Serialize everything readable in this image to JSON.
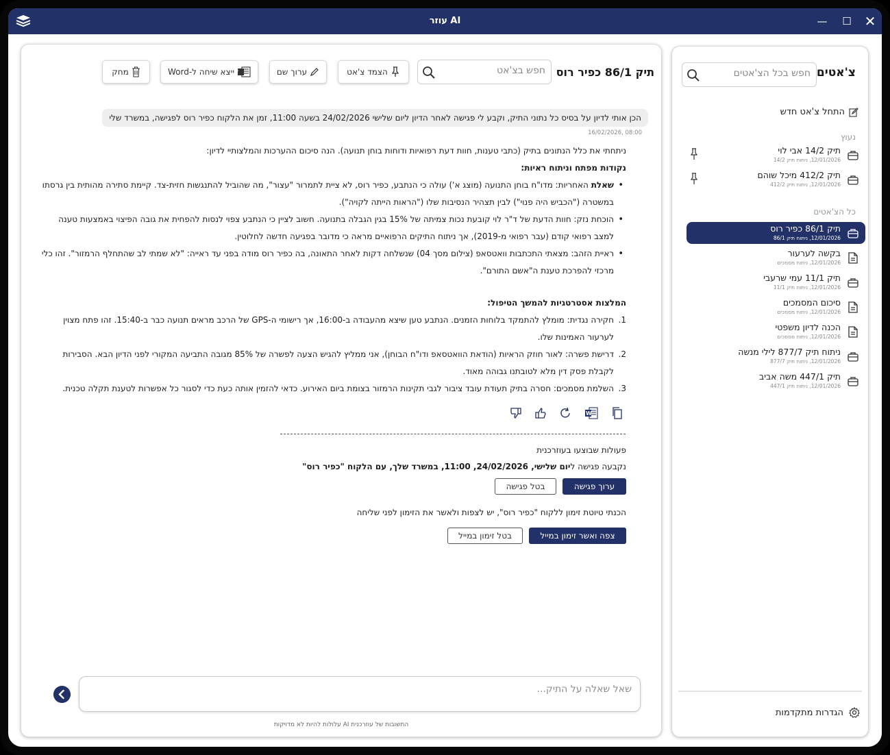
{
  "window": {
    "title": "עוזר AI",
    "minimize": "—",
    "maximize": "☐",
    "close": "✕"
  },
  "sidebar": {
    "title": "צ'אטים",
    "search_placeholder": "חפש בכל הצ'אטים",
    "new_chat": "התחל צ'אט חדש",
    "pinned_label": "נעוץ",
    "pinned": [
      {
        "name": "תיק 14/2 אבי לוי",
        "sub": "12/01/2026, ניתוח תיק 14/2",
        "icon": "briefcase-icon"
      },
      {
        "name": "תיק 412/2 מיכל שוהם",
        "sub": "12/01/2026, ניתוח תיק 412/2",
        "icon": "briefcase-icon"
      }
    ],
    "all_label": "כל הצ'אטים",
    "all": [
      {
        "name": "תיק 86/1 כפיר רוס",
        "sub": "12/01/2026, ניתוח תיק 86/1",
        "icon": "briefcase-icon"
      },
      {
        "name": "בקשה לערעור",
        "sub": "12/01/2026, ניתוח מסמכים",
        "icon": "document-icon"
      },
      {
        "name": "תיק 11/1 עמי שרעבי",
        "sub": "12/01/2026, ניתוח תיק 11/1",
        "icon": "briefcase-icon"
      },
      {
        "name": "סיכום המסמכים",
        "sub": "12/01/2026, ניתוח מסמכים",
        "icon": "document-icon"
      },
      {
        "name": "הכנה לדיון משפטי",
        "sub": "12/01/2026, ניתוח מסמכים",
        "icon": "document-icon"
      },
      {
        "name": "ניתוח תיק 877/7 לילי מנשה",
        "sub": "12/01/2026, ניתוח תיק 877/7",
        "icon": "briefcase-icon"
      },
      {
        "name": "תיק 447/1 משה אביב",
        "sub": "12/01/2026, ניתוח תיק 447/1",
        "icon": "briefcase-icon"
      }
    ],
    "settings": "הגדרות מתקדמות"
  },
  "main": {
    "case_title": "תיק 86/1 כפיר רוס",
    "search_placeholder": "חפש בצ'אט",
    "buttons": {
      "pin": "הצמד צ'אט",
      "rename": "ערוך שם",
      "export": "ייצא שיחה ל-Word",
      "delete": "מחק"
    },
    "user_message": "הכן אותי לדיון על בסיס כל נתוני התיק, וקבע לי פגישה לאחר הדיון ליום שלישי 24/02/2026 בשעה 11:00, זמן את הלקוח כפיר רוס לפגישה, במשרד שלי",
    "user_time": "16/02/2026, 08:00",
    "answer": {
      "intro": "ניתחתי את כלל הנתונים בתיק (כתבי טענות, חוות דעת רפואיות ודוחות בוחן תנועה). הנה סיכום ההערכות והמלצותיי לדיון:",
      "key_points_title": "נקודות מפתח וניתוח ראיות:",
      "key_points": [
        {
          "lead": "שאלת",
          "text": " האחריות: מדו\"ח בוחן התנועה (מוצג א') עולה כי הנתבע, כפיר רוס, לא ציית לתמרור \"עצור\", מה שהוביל להתנגשות חזית-צד. קיימת סתירה מהותית בין גרסתו במשטרה (\"הכביש היה פנוי\") לבין תצהיר הנסיבות שלו (\"הראות הייתה לקויה\")."
        },
        {
          "lead": "",
          "text": "הוכחת נזק: חוות הדעת של ד\"ר לוי קובעת נכות צמיתה של 15% בגין הגבלה בתנועה. חשוב לציין כי הנתבע צפוי לנסות להפחית את גובה הפיצוי באמצעות טענה למצב רפואי קודם (עבר רפואי מ-2019), אך ניתוח התיקים הרפואיים מראה כי מדובר בפגיעה חדשה לחלוטין."
        },
        {
          "lead": "",
          "text": "ראיית הזהב: מצאתי התכתבות וואטסאפ (צילום מסך 04) שנשלחה דקות לאחר התאונה, בה כפיר רוס מודה בפני עד ראייה: \"לא שמתי לב שהתחלף הרמזור\". זהו כלי מרכזי להפרכת טענת ה\"אשם התורם\"."
        }
      ],
      "recommend_title": "המלצות אסטרטגיות להמשך הטיפול:",
      "recommendations": [
        {
          "num": "1.",
          "text": "חקירה נגדית: מומלץ להתמקד בלוחות הזמנים. הנתבע טען שיצא מהעבודה ב-16:00, אך רישומי ה-GPS של הרכב מראים תנועה כבר ב-15:40. זהו פתח מצוין לערעור האמינות שלו."
        },
        {
          "num": "2.",
          "text": "דרישת פשרה: לאור חוזק הראיות (הודאת הוואטסאפ ודו\"ח הבוחן), אני ממליץ להגיש הצעה לפשרה של 85% מגובה התביעה המקורי לפני הדיון הבא. הסבירות לקבלת פסק דין מלא לטובתנו גבוהה מאוד."
        },
        {
          "num": "3.",
          "text": "השלמת מסמכים: חסרה בתיק תעודת עובד ציבור לגבי תקינות הרמזור בצומת ביום האירוע. כדאי להזמין אותה כעת כדי לסגור כל אפשרות לטענת תקלה טכנית."
        }
      ]
    },
    "ops": {
      "title": "פעולות שבוצעו בעוזרכנית",
      "meet_prefix": "נקבעה פגישה ל",
      "meet_bold": "יום שלישי, 24/02/2026, 11:00, במשרד שלך, עם הלקוח \"כפיר רוס\"",
      "edit_meeting": "ערוך פגישה",
      "cancel_meeting": "בטל פגישה",
      "invite_text": "הכנתי טיוטת זימון ללקוח \"כפיר רוס\", יש לצפות ולאשר את הזימון לפני שליחה",
      "approve_invite": "צפה ואשר זימון במייל",
      "cancel_invite": "בטל זימון במייל"
    },
    "composer_placeholder": "שאל שאלה על התיק...",
    "disclaimer": "התשובות של עוזרכנית AI עלולות להיות לא מדויקות"
  },
  "colors": {
    "brand": "#223167",
    "panel_border": "#dadada"
  }
}
